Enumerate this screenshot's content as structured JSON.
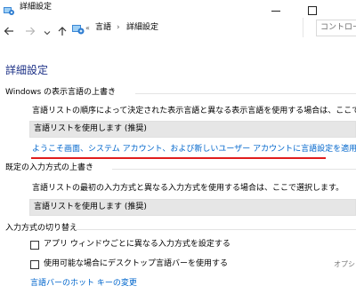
{
  "window": {
    "title": "詳細設定",
    "minimize_symbol": "—",
    "maximize_symbol": "□"
  },
  "nav": {
    "back_symbol": "←",
    "forward_symbol": "→",
    "recent_symbol": "⌄",
    "up_symbol": "↑",
    "separator_lead": "«",
    "breadcrumb": [
      "言語",
      "詳細設定"
    ],
    "crumb_separator": "›",
    "search_placeholder": "コントロール"
  },
  "page": {
    "title": "詳細設定"
  },
  "display_language_override": {
    "heading": "Windows の表示言語の上書き",
    "description": "言語リストの順序によって決定された表示言語と異なる表示言語を使用する場合は、ここで選択します。",
    "dropdown_value": "言語リストを使用します (推奨)",
    "welcome_link": "ようこそ画面、システム アカウント、および新しいユーザー アカウントに言語設定を適用する"
  },
  "default_input_override": {
    "heading": "既定の入力方式の上書き",
    "description": "言語リストの最初の入力方式と異なる入力方式を使用する場合は、ここで選択します。",
    "dropdown_value": "言語リストを使用します (推奨)"
  },
  "input_switching": {
    "heading": "入力方式の切り替え",
    "checkbox1_label": "アプリ ウィンドウごとに異なる入力方式を設定する",
    "checkbox1_checked": false,
    "checkbox2_label": "使用可能な場合にデスクトップ言語バーを使用する",
    "checkbox2_checked": false,
    "options_link": "オプシ",
    "hotkeys_link": "言語バーのホット キーの変更"
  },
  "colors": {
    "accent_title": "#1e3287",
    "link": "#0066cc",
    "highlight_underline": "#e01d1d",
    "dropdown_bg": "#e6e6e6"
  }
}
